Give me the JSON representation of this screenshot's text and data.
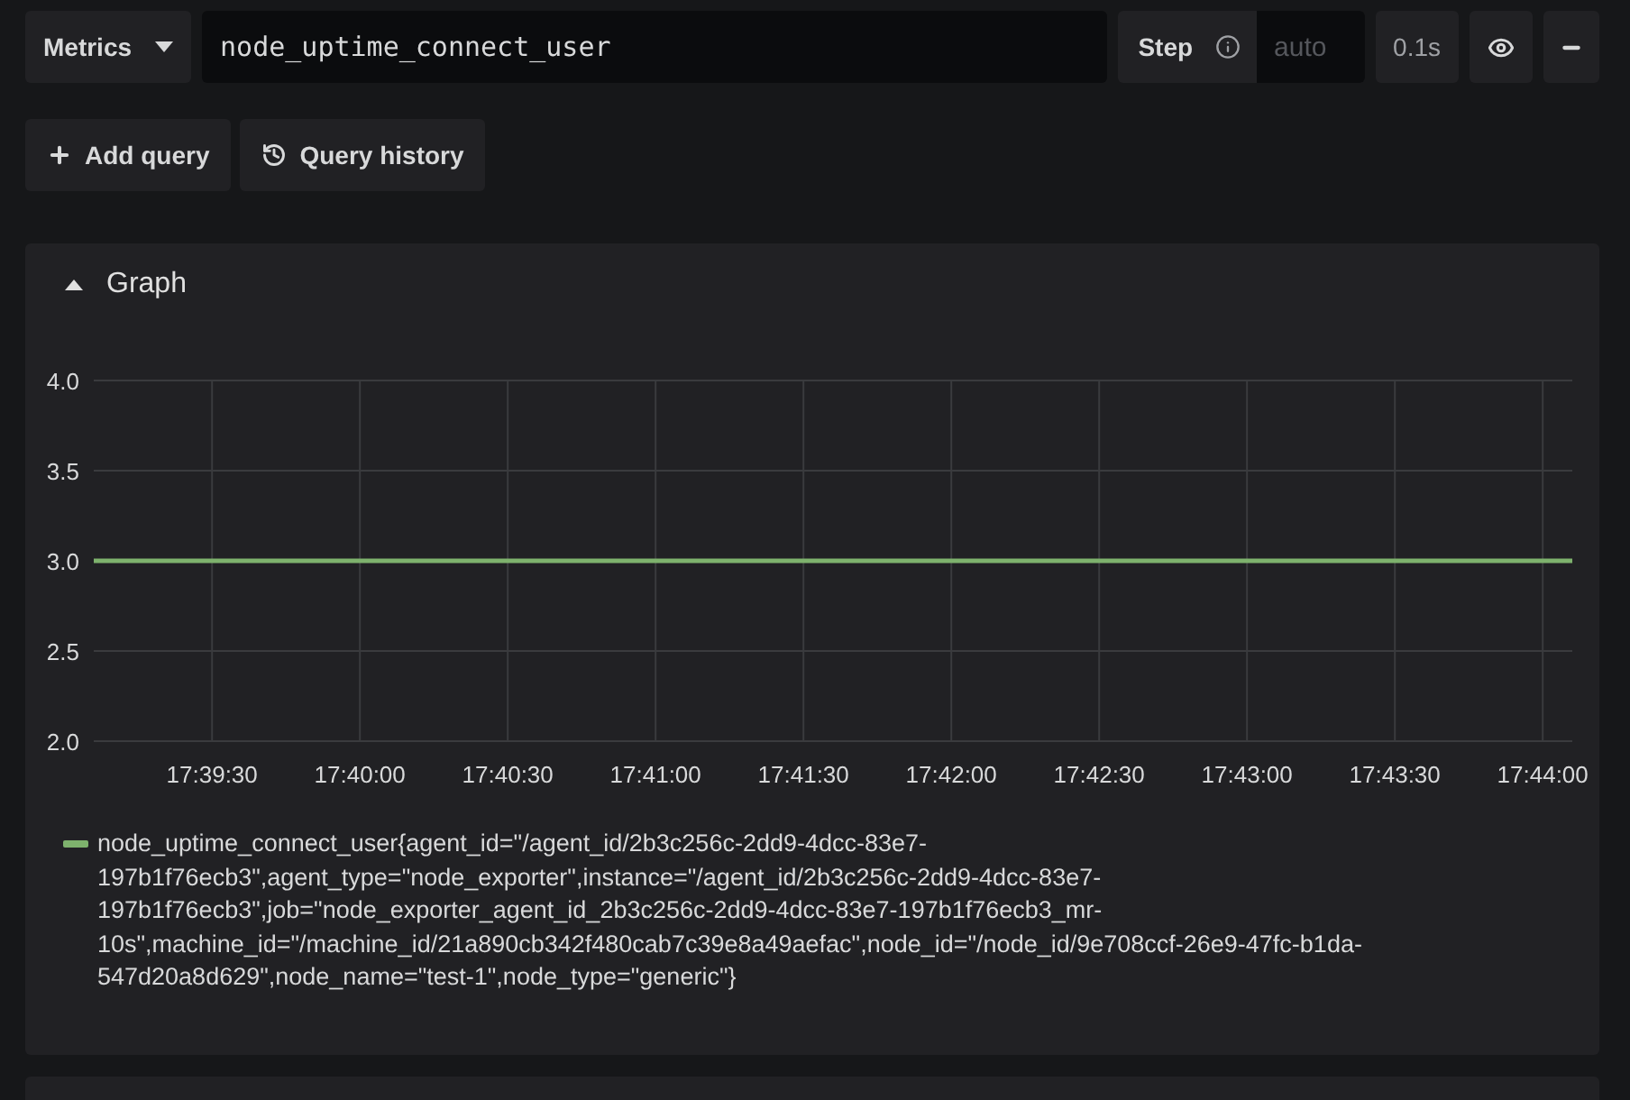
{
  "query_row": {
    "datasource": "Metrics",
    "query": "node_uptime_connect_user",
    "step_label": "Step",
    "step_placeholder": "auto",
    "duration": "0.1s"
  },
  "actions": [
    {
      "kind": "add",
      "label": "Add query"
    },
    {
      "kind": "history",
      "label": "Query history"
    }
  ],
  "graph_panel": {
    "title": "Graph",
    "expanded": true,
    "chart_data": {
      "type": "line",
      "grid": true,
      "xlim": [
        63546,
        63846
      ],
      "ylim": [
        2,
        4
      ],
      "yticks": [
        {
          "value": 2,
          "label": "2.0"
        },
        {
          "value": 2.5,
          "label": "2.5"
        },
        {
          "value": 3,
          "label": "3.0"
        },
        {
          "value": 3.5,
          "label": "3.5"
        },
        {
          "value": 4,
          "label": "4.0"
        }
      ],
      "xticks": [
        {
          "value": 63570,
          "label": "17:39:30"
        },
        {
          "value": 63600,
          "label": "17:40:00"
        },
        {
          "value": 63630,
          "label": "17:40:30"
        },
        {
          "value": 63660,
          "label": "17:41:00"
        },
        {
          "value": 63690,
          "label": "17:41:30"
        },
        {
          "value": 63720,
          "label": "17:42:00"
        },
        {
          "value": 63750,
          "label": "17:42:30"
        },
        {
          "value": 63780,
          "label": "17:43:00"
        },
        {
          "value": 63810,
          "label": "17:43:30"
        },
        {
          "value": 63840,
          "label": "17:44:00"
        }
      ],
      "x": [
        63546,
        63846
      ],
      "series": [
        {
          "name": "node_uptime_connect_user{agent_id=\"/agent_id/2b3c256c-2dd9-4dcc-83e7-197b1f76ecb3\",agent_type=\"node_exporter\",instance=\"/agent_id/2b3c256c-2dd9-4dcc-83e7-197b1f76ecb3\",job=\"node_exporter_agent_id_2b3c256c-2dd9-4dcc-83e7-197b1f76ecb3_mr-10s\",machine_id=\"/machine_id/21a890cb342f480cab7c39e8a49aefac\",node_id=\"/node_id/9e708ccf-26e9-47fc-b1da-547d20a8d629\",node_name=\"test-1\",node_type=\"generic\"}",
          "color": "#7eb26d",
          "values": [
            3,
            3
          ]
        }
      ]
    }
  }
}
